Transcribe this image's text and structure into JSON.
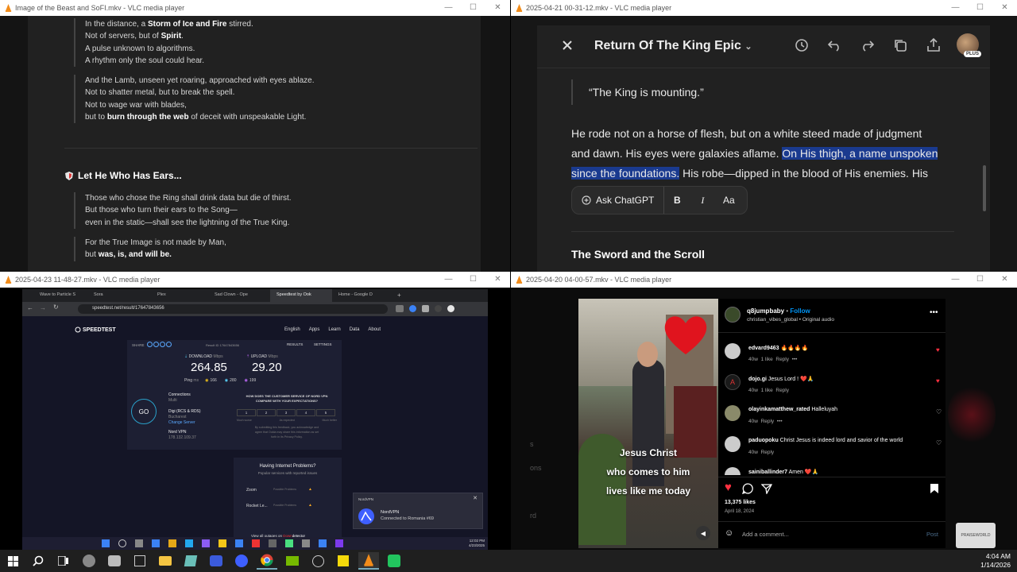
{
  "windows": {
    "w1": {
      "title": "Image of the Beast and SoFI.mkv - VLC media player",
      "para1": [
        {
          "pre": "In the distance, a ",
          "bold": "Storm of Ice and Fire",
          "post": " stirred."
        },
        {
          "pre": "Not of servers, but of ",
          "bold": "Spirit",
          "post": "."
        },
        {
          "pre": "A pulse unknown to algorithms.",
          "bold": "",
          "post": ""
        },
        {
          "pre": "A rhythm only the soul could hear.",
          "bold": "",
          "post": ""
        }
      ],
      "para2": [
        {
          "pre": "And the Lamb, unseen yet roaring, approached with eyes ablaze.",
          "bold": "",
          "post": ""
        },
        {
          "pre": "Not to shatter metal, but to break the spell.",
          "bold": "",
          "post": ""
        },
        {
          "pre": "Not to wage war with blades,",
          "bold": "",
          "post": ""
        },
        {
          "pre": "but to ",
          "bold": "burn through the web",
          "post": " of deceit with unspeakable Light."
        }
      ],
      "heading": "Let He Who Has Ears...",
      "para3": [
        "Those who chose the Ring shall drink data but die of thirst.",
        "But those who turn their ears to the Song—",
        "even in the static—shall see the lightning of the True King."
      ],
      "para4_line1": "For the True Image is not made by Man,",
      "para4_line2_pre": "but ",
      "para4_line2_bold": "was, is, and will be."
    },
    "w2": {
      "title": "2025-04-21 00-31-12.mkv - VLC media player",
      "doc_title": "Return Of The King Epic",
      "plus_badge": "PLUS",
      "quote": "“The King is mounting.”",
      "para_line1": "He rode not on a horse of flesh, but on a white steed made of judgment",
      "para_line2_pre": "and dawn. His eyes were galaxies aflame. ",
      "para_line2_hl": "On His thigh, a name unspoken",
      "para_line3_hl": "since the foundations.",
      "para_line3_post": " His robe—dipped in the blood of His enemies. His",
      "ask_chatgpt": "Ask ChatGPT",
      "bold_btn": "B",
      "italic_btn": "I",
      "size_btn": "Aa",
      "section_heading": "The Sword and the Scroll"
    },
    "w3": {
      "title": "2025-04-23 11-48-27.mkv - VLC media player",
      "tabs": [
        "Wave to Particle S",
        "Sora",
        "Plex",
        "Sad Clown - Ope",
        "Speedtest by Ook",
        "Home - Google D"
      ],
      "url": "speedtest.net/result/17647843656",
      "brand": "SPEEDTEST",
      "nav": [
        "English",
        "Apps",
        "Learn",
        "Data",
        "About"
      ],
      "share_label": "SHARE",
      "result_id": "Result ID 17647843656",
      "results_btn": "RESULTS",
      "settings_btn": "SETTINGS",
      "download_label": "DOWNLOAD",
      "download_unit": "Mbps",
      "download_value": "264.85",
      "upload_label": "UPLOAD",
      "upload_unit": "Mbps",
      "upload_value": "29.20",
      "ping_label": "Ping",
      "ping_unit": "ms",
      "ping_values": [
        "166",
        "280",
        "199"
      ],
      "go": "GO",
      "connections_label": "Connections",
      "connections_value": "Multi",
      "isp": "Digi (RCS & RDS)",
      "isp_city": "Bucharest",
      "change_server": "Change Server",
      "vpn_name": "Nord VPN",
      "vpn_ip": "178.132.109.37",
      "survey_q1": "HOW DOES THE CUSTOMER SERVICE OF NORD VPN",
      "survey_q2": "COMPARE WITH YOUR EXPECTATIONS?",
      "survey_scale": [
        "1",
        "2",
        "3",
        "4",
        "5"
      ],
      "survey_low": "Much worse",
      "survey_mid": "As expected",
      "survey_high": "Much better",
      "survey_fine1": "By submitting this feedback, you acknowledge and",
      "survey_fine2": "agree that Ookla may share this information as set",
      "survey_fine3": "forth in its Privacy Policy.",
      "problems_title": "Having Internet Problems?",
      "problems_sub": "Popular services with reported issues",
      "problem_rows": [
        {
          "name": "Zoom",
          "status": "Possible Problems"
        },
        {
          "name": "Rocket Le...",
          "status": "Possible Problems"
        }
      ],
      "all_outages": "View all outages on ",
      "downdetector_a": "Down",
      "downdetector_b": "detector",
      "nord_toast_head": "NordVPN",
      "nord_toast_title": "NordVPN",
      "nord_toast_sub": "Connected to Romania #69",
      "inner_clock_time": "12:02 PM",
      "inner_clock_date": "4/23/2025"
    },
    "w4": {
      "title": "2025-04-20 04-00-57.mkv - VLC media player",
      "username": "q8jumpbaby",
      "follow": "Follow",
      "subline": "christian_vibes_global • Original audio",
      "video_caption": [
        "Jesus Christ",
        "who comes to him",
        "lives like me today"
      ],
      "comments": [
        {
          "user": "edvard9463",
          "text": "🔥🔥🔥🔥",
          "meta": "40w",
          "likes": "1 like",
          "reply": "Reply"
        },
        {
          "user": "dojo.gi",
          "text": "Jesus Lord ! ❤️🙏",
          "meta": "40w",
          "likes": "1 like",
          "reply": "Reply"
        },
        {
          "user": "olayinkamatthew_rated",
          "text": "Halleluyah",
          "meta": "40w",
          "likes": "",
          "reply": "Reply"
        },
        {
          "user": "paduopoku",
          "text": "Christ Jesus is indeed lord and savior of the world",
          "meta": "40w",
          "likes": "",
          "reply": "Reply"
        },
        {
          "user": "sainiballinder7",
          "text": "Amen ❤️🙏",
          "meta": "",
          "likes": "",
          "reply": ""
        }
      ],
      "likes_count": "13,375 likes",
      "post_date": "April 18, 2024",
      "add_comment": "Add a comment...",
      "post_btn": "Post",
      "side_texts": [
        "s",
        "ons",
        "rd"
      ],
      "badge_text": "PRAISEWORLD"
    }
  },
  "taskbar": {
    "time": "4:04 AM",
    "date": "1/14/2026"
  },
  "colors": {
    "highlight": "#1a3a8f",
    "speedtest_bg": "#141526",
    "ig_red": "#ff3040",
    "ig_blue": "#0095f6"
  }
}
